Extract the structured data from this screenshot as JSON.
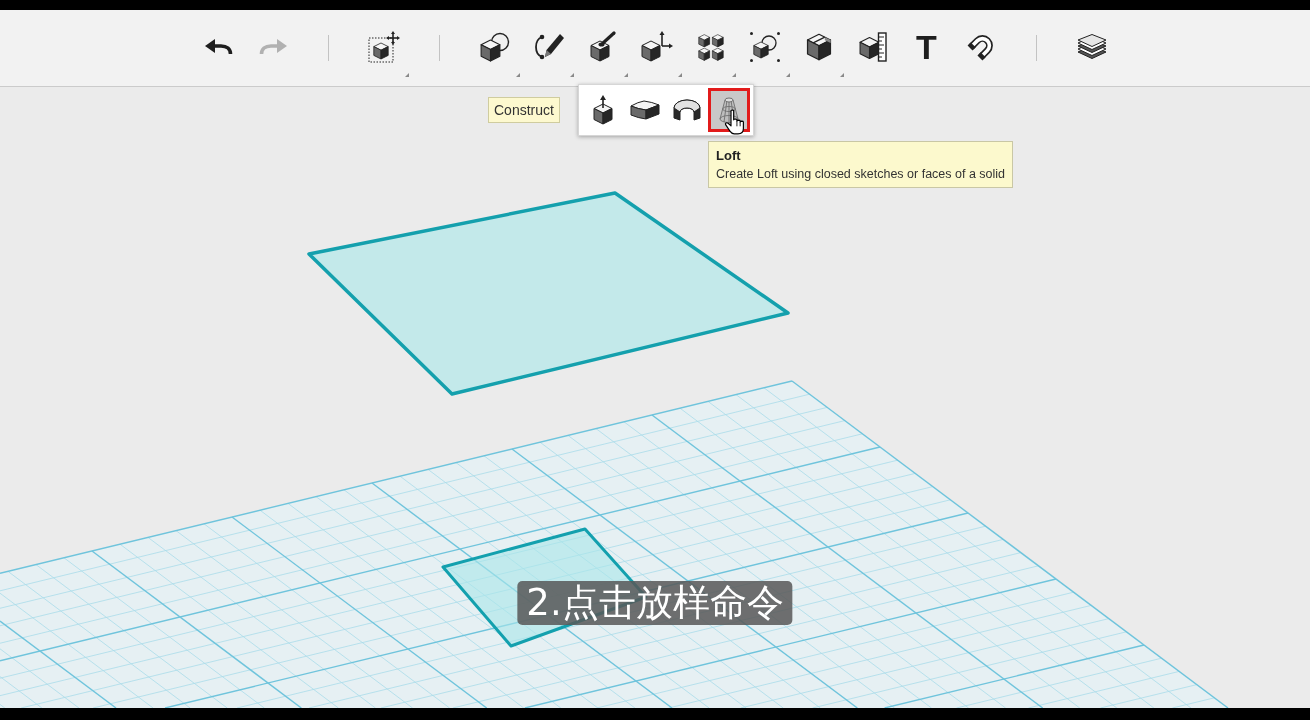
{
  "toolbar": {
    "groups": [
      {
        "items": [
          {
            "kind": "undo",
            "disabled": false,
            "menu": false
          },
          {
            "kind": "redo",
            "disabled": true,
            "menu": false
          }
        ]
      },
      {
        "items": [
          {
            "kind": "transform",
            "disabled": false,
            "menu": true
          }
        ]
      },
      {
        "items": [
          {
            "kind": "primitives",
            "disabled": false,
            "menu": true
          },
          {
            "kind": "sketch",
            "disabled": false,
            "menu": true
          },
          {
            "kind": "construct",
            "disabled": false,
            "menu": true
          },
          {
            "kind": "modify",
            "disabled": false,
            "menu": true
          },
          {
            "kind": "pattern",
            "disabled": false,
            "menu": true
          },
          {
            "kind": "grouping",
            "disabled": false,
            "menu": true
          },
          {
            "kind": "combine",
            "disabled": false,
            "menu": true
          },
          {
            "kind": "measure",
            "disabled": false,
            "menu": false
          },
          {
            "kind": "text",
            "glyph": "T",
            "disabled": false,
            "menu": false
          },
          {
            "kind": "snap",
            "disabled": false,
            "menu": false
          }
        ]
      },
      {
        "items": [
          {
            "kind": "materials",
            "disabled": false,
            "menu": false
          }
        ]
      }
    ]
  },
  "flyout": {
    "title": "Construct",
    "items": [
      {
        "kind": "extrude",
        "selected": false
      },
      {
        "kind": "sweep",
        "selected": false
      },
      {
        "kind": "revolve",
        "selected": false
      },
      {
        "kind": "loft",
        "selected": true
      }
    ]
  },
  "tooltip": {
    "title": "Loft",
    "text": "Create Loft using closed sketches or faces of a solid"
  },
  "subtitle": "2.点击放样命令"
}
